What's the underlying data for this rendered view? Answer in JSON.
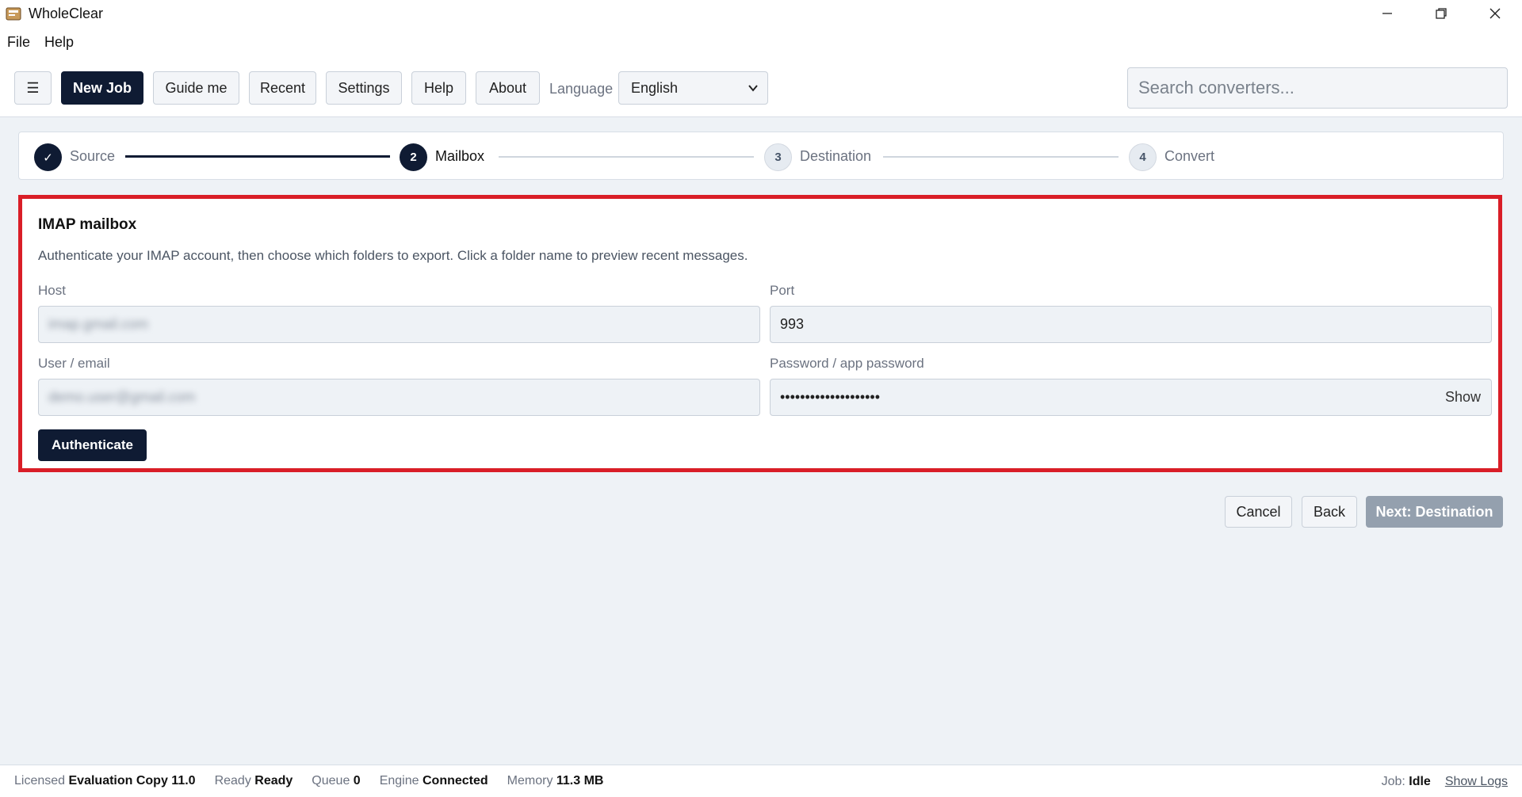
{
  "window": {
    "title": "WholeClear"
  },
  "menu": [
    "File",
    "Help"
  ],
  "toolbar": {
    "menu_icon": "☰",
    "new_job": "New Job",
    "guide_me": "Guide me",
    "recent": "Recent",
    "settings": "Settings",
    "help": "Help",
    "about": "About",
    "language_label": "Language",
    "language_value": "English",
    "search_placeholder": "Search converters..."
  },
  "stepper": {
    "steps": [
      {
        "number": "✓",
        "label": "Source",
        "state": "done"
      },
      {
        "number": "2",
        "label": "Mailbox",
        "state": "active"
      },
      {
        "number": "3",
        "label": "Destination",
        "state": "todo"
      },
      {
        "number": "4",
        "label": "Convert",
        "state": "todo"
      }
    ]
  },
  "imap": {
    "title": "IMAP mailbox",
    "description": "Authenticate your IMAP account, then choose which folders to export. Click a folder name to preview recent messages.",
    "host_label": "Host",
    "host_value": "imap.gmail.com",
    "port_label": "Port",
    "port_value": "993",
    "user_label": "User / email",
    "user_value": "demo.user@gmail.com",
    "password_label": "Password / app password",
    "password_value": "••••••••••••••••••••",
    "show_label": "Show",
    "authenticate_label": "Authenticate"
  },
  "actions": {
    "cancel": "Cancel",
    "back": "Back",
    "next": "Next: Destination"
  },
  "status": {
    "licensed_label": "Licensed",
    "licensed_value": "Evaluation Copy 11.0",
    "ready_label": "Ready",
    "ready_value": "Ready",
    "queue_label": "Queue",
    "queue_value": "0",
    "engine_label": "Engine",
    "engine_value": "Connected",
    "memory_label": "Memory",
    "memory_value": "11.3 MB",
    "job_label": "Job:",
    "job_value": "Idle",
    "show_logs": "Show Logs"
  },
  "colors": {
    "primary": "#0f1b33",
    "highlight_border": "#d91e27",
    "background": "#eef2f6"
  }
}
